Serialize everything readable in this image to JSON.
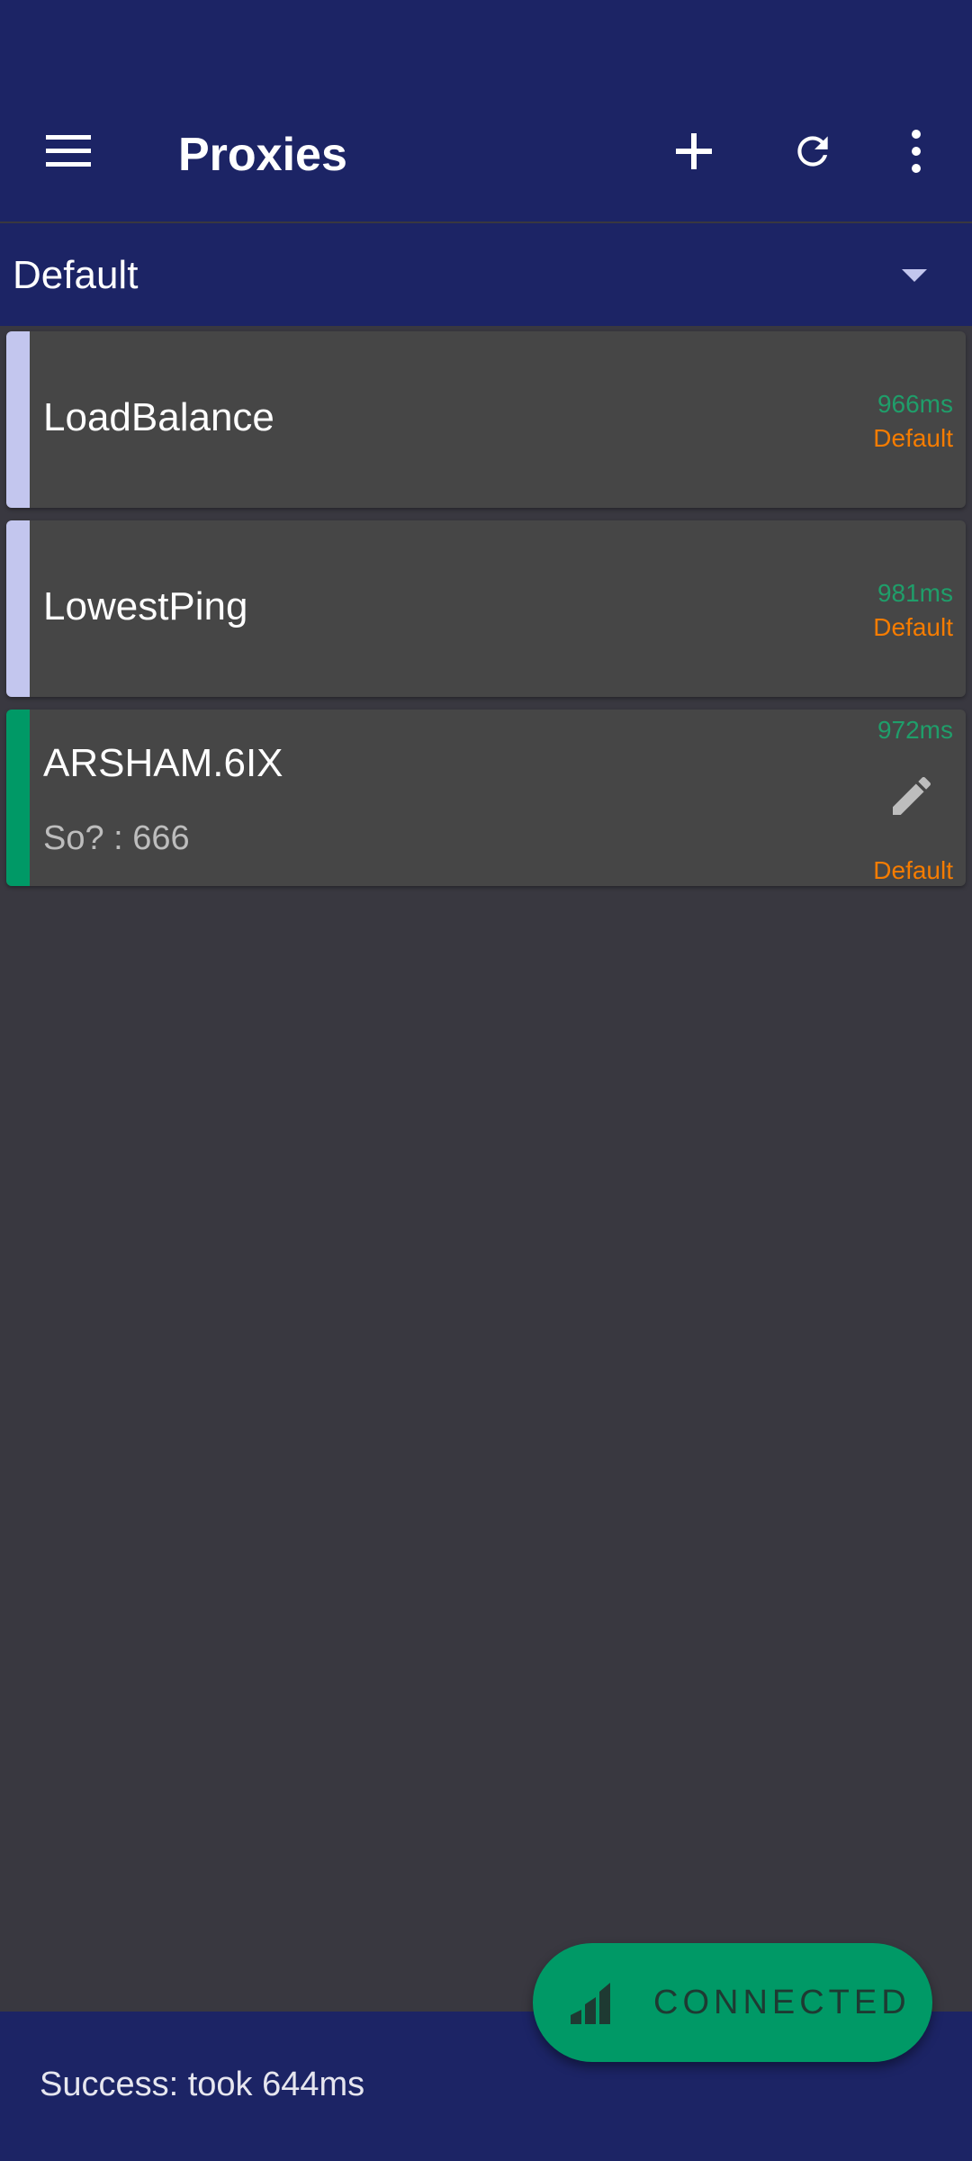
{
  "app": {
    "title": "Proxies"
  },
  "toolbar": {
    "menu_icon": "hamburger-menu-icon",
    "add_icon": "plus-icon",
    "refresh_icon": "refresh-icon",
    "more_icon": "more-vert-icon"
  },
  "group_selector": {
    "selected": "Default",
    "icon": "dropdown-arrow-icon"
  },
  "proxies": [
    {
      "name": "LoadBalance",
      "ping": "966ms",
      "type": "Default",
      "subtitle": "",
      "stripe_color": "#c3c6ee",
      "editable": false
    },
    {
      "name": "LowestPing",
      "ping": "981ms",
      "type": "Default",
      "subtitle": "",
      "stripe_color": "#c3c6ee",
      "editable": false
    },
    {
      "name": "ARSHAM.6IX",
      "ping": "972ms",
      "type": "Default",
      "subtitle": "So? : 666",
      "stripe_color": "#009966",
      "editable": true
    }
  ],
  "snackbar": {
    "message": "Success: took 644ms"
  },
  "fab": {
    "label": "CONNECTED",
    "icon": "signal-bars-icon"
  },
  "colors": {
    "primary": "#1c2465",
    "background": "#393840",
    "card": "#464646",
    "ping_green": "#1f9e6a",
    "type_orange": "#f57c00",
    "connected_green": "#009966"
  }
}
